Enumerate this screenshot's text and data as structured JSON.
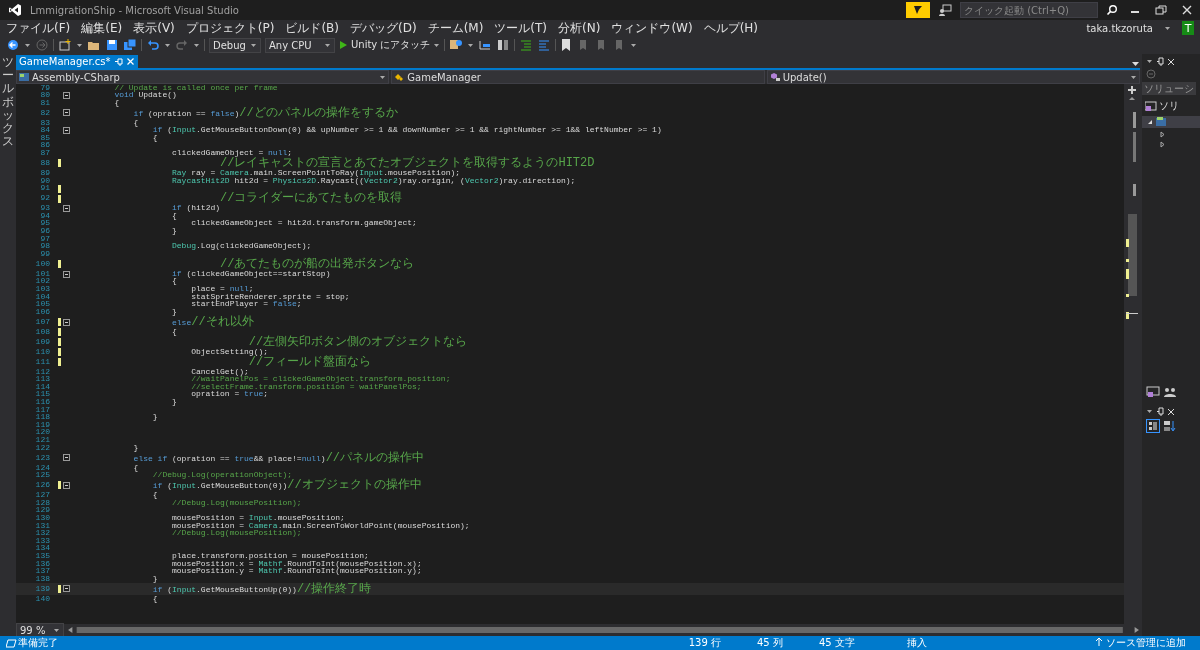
{
  "window": {
    "title": "LmmigrationShip - Microsoft Visual Studio"
  },
  "quick_launch": {
    "placeholder": "クイック起動 (Ctrl+Q)"
  },
  "menu": [
    "ファイル(F)",
    "編集(E)",
    "表示(V)",
    "プロジェクト(P)",
    "ビルド(B)",
    "デバッグ(D)",
    "チーム(M)",
    "ツール(T)",
    "分析(N)",
    "ウィンドウ(W)",
    "ヘルプ(H)"
  ],
  "account": {
    "user": "taka.tkzoruta",
    "avatar": "T"
  },
  "toolbar": {
    "configuration": "Debug",
    "platform": "Any CPU",
    "start": "Unity にアタッチ"
  },
  "toolbox": {
    "label": "ツールボックス"
  },
  "tabs": [
    {
      "label": "GameManager.cs*",
      "selected": true
    }
  ],
  "navigation": {
    "project": "Assembly-CSharp",
    "type": "GameManager",
    "member": "Update()"
  },
  "editor": {
    "zoom": "99 %",
    "lines": [
      {
        "n": "79",
        "changed": false,
        "fold": false,
        "current": false,
        "code": [
          {
            "kind": "comment",
            "t": "        // Update is called once per frame"
          }
        ]
      },
      {
        "n": "80",
        "changed": false,
        "fold": true,
        "current": false,
        "code": [
          {
            "kind": "keyword",
            "t": "        void"
          },
          {
            "kind": "plain",
            "t": " Update()"
          }
        ]
      },
      {
        "n": "81",
        "changed": false,
        "fold": false,
        "current": false,
        "code": [
          {
            "kind": "plain",
            "t": "        {"
          }
        ]
      },
      {
        "n": "82",
        "changed": false,
        "fold": true,
        "current": false,
        "code": [
          {
            "kind": "keyword",
            "t": "            if"
          },
          {
            "kind": "plain",
            "t": " (opration == "
          },
          {
            "kind": "keyword",
            "t": "false"
          },
          {
            "kind": "plain",
            "t": ")"
          },
          {
            "kind": "comment_ja",
            "t": "//どのパネルの操作をするか"
          }
        ]
      },
      {
        "n": "83",
        "changed": false,
        "fold": false,
        "current": false,
        "code": [
          {
            "kind": "plain",
            "t": "            {"
          }
        ]
      },
      {
        "n": "84",
        "changed": false,
        "fold": true,
        "current": false,
        "code": [
          {
            "kind": "keyword",
            "t": "                if"
          },
          {
            "kind": "plain",
            "t": " ("
          },
          {
            "kind": "type",
            "t": "Input"
          },
          {
            "kind": "plain",
            "t": ".GetMouseButtonDown(0) && upNumber >= 1 && downNumber >= 1 && rightNumber >= 1&& leftNumber >= 1)"
          }
        ]
      },
      {
        "n": "85",
        "changed": false,
        "fold": false,
        "current": false,
        "code": [
          {
            "kind": "plain",
            "t": "                {"
          }
        ]
      },
      {
        "n": "86",
        "changed": false,
        "fold": false,
        "current": false
      },
      {
        "n": "87",
        "changed": false,
        "fold": false,
        "current": false,
        "code": [
          {
            "kind": "plain",
            "t": "                    clickedGameObject = "
          },
          {
            "kind": "keyword",
            "t": "null"
          },
          {
            "kind": "plain",
            "t": ";"
          }
        ]
      },
      {
        "n": "88",
        "changed": true,
        "fold": false,
        "current": false,
        "code": [
          {
            "kind": "comment_ja",
            "t": "                    //レイキャストの宣言とあてたオブジェクトを取得するようのHIT2D"
          }
        ]
      },
      {
        "n": "89",
        "changed": false,
        "fold": false,
        "current": false,
        "code": [
          {
            "kind": "type",
            "t": "                    Ray"
          },
          {
            "kind": "plain",
            "t": " ray = "
          },
          {
            "kind": "type",
            "t": "Camera"
          },
          {
            "kind": "plain",
            "t": ".main.ScreenPointToRay("
          },
          {
            "kind": "type",
            "t": "Input"
          },
          {
            "kind": "plain",
            "t": ".mousePosition);"
          }
        ]
      },
      {
        "n": "90",
        "changed": false,
        "fold": false,
        "current": false,
        "code": [
          {
            "kind": "type",
            "t": "                    RaycastHit2D"
          },
          {
            "kind": "plain",
            "t": " hit2d = "
          },
          {
            "kind": "type",
            "t": "Physics2D"
          },
          {
            "kind": "plain",
            "t": ".Raycast(("
          },
          {
            "kind": "type",
            "t": "Vector2"
          },
          {
            "kind": "plain",
            "t": ")ray.origin, ("
          },
          {
            "kind": "type",
            "t": "Vector2"
          },
          {
            "kind": "plain",
            "t": ")ray.direction);"
          }
        ]
      },
      {
        "n": "91",
        "changed": true,
        "fold": false,
        "current": false
      },
      {
        "n": "92",
        "changed": true,
        "fold": false,
        "current": false,
        "code": [
          {
            "kind": "comment_ja",
            "t": "                    //コライダーにあてたものを取得"
          }
        ]
      },
      {
        "n": "93",
        "changed": false,
        "fold": true,
        "current": false,
        "code": [
          {
            "kind": "keyword",
            "t": "                    if"
          },
          {
            "kind": "plain",
            "t": " (hit2d)"
          }
        ]
      },
      {
        "n": "94",
        "changed": false,
        "fold": false,
        "current": false,
        "code": [
          {
            "kind": "plain",
            "t": "                    {"
          }
        ]
      },
      {
        "n": "95",
        "changed": false,
        "fold": false,
        "current": false,
        "code": [
          {
            "kind": "plain",
            "t": "                        clickedGameObject = hit2d.transform.gameObject;"
          }
        ]
      },
      {
        "n": "96",
        "changed": false,
        "fold": false,
        "current": false,
        "code": [
          {
            "kind": "plain",
            "t": "                    }"
          }
        ]
      },
      {
        "n": "97",
        "changed": false,
        "fold": false,
        "current": false
      },
      {
        "n": "98",
        "changed": false,
        "fold": false,
        "current": false,
        "code": [
          {
            "kind": "type",
            "t": "                    Debug"
          },
          {
            "kind": "plain",
            "t": ".Log(clickedGameObject);"
          }
        ]
      },
      {
        "n": "99",
        "changed": false,
        "fold": false,
        "current": false
      },
      {
        "n": "100",
        "changed": true,
        "fold": false,
        "current": false,
        "code": [
          {
            "kind": "comment_ja",
            "t": "                    //あてたものが船の出発ボタンなら"
          }
        ]
      },
      {
        "n": "101",
        "changed": false,
        "fold": true,
        "current": false,
        "code": [
          {
            "kind": "keyword",
            "t": "                    if"
          },
          {
            "kind": "plain",
            "t": " (clickedGameObject==startStop)"
          }
        ]
      },
      {
        "n": "102",
        "changed": false,
        "fold": false,
        "current": false,
        "code": [
          {
            "kind": "plain",
            "t": "                    {"
          }
        ]
      },
      {
        "n": "103",
        "changed": false,
        "fold": false,
        "current": false,
        "code": [
          {
            "kind": "plain",
            "t": "                        place = "
          },
          {
            "kind": "keyword",
            "t": "null"
          },
          {
            "kind": "plain",
            "t": ";"
          }
        ]
      },
      {
        "n": "104",
        "changed": false,
        "fold": false,
        "current": false,
        "code": [
          {
            "kind": "plain",
            "t": "                        statSpriteRenderer.sprite = stop;"
          }
        ]
      },
      {
        "n": "105",
        "changed": false,
        "fold": false,
        "current": false,
        "code": [
          {
            "kind": "plain",
            "t": "                        startEndPlayer = "
          },
          {
            "kind": "keyword",
            "t": "false"
          },
          {
            "kind": "plain",
            "t": ";"
          }
        ]
      },
      {
        "n": "106",
        "changed": false,
        "fold": false,
        "current": false,
        "code": [
          {
            "kind": "plain",
            "t": "                    }"
          }
        ]
      },
      {
        "n": "107",
        "changed": true,
        "fold": true,
        "current": false,
        "code": [
          {
            "kind": "keyword",
            "t": "                    else"
          },
          {
            "kind": "comment_ja",
            "t": "//それ以外"
          }
        ]
      },
      {
        "n": "108",
        "changed": true,
        "fold": false,
        "current": false,
        "code": [
          {
            "kind": "plain",
            "t": "                    {"
          }
        ]
      },
      {
        "n": "109",
        "changed": true,
        "fold": false,
        "current": false,
        "code": [
          {
            "kind": "comment_ja",
            "t": "                        //左側矢印ボタン側のオブジェクトなら"
          }
        ]
      },
      {
        "n": "110",
        "changed": true,
        "fold": false,
        "current": false,
        "code": [
          {
            "kind": "plain",
            "t": "                        ObjectSetting();"
          }
        ]
      },
      {
        "n": "111",
        "changed": true,
        "fold": false,
        "current": false,
        "code": [
          {
            "kind": "comment_ja",
            "t": "                        //フィールド盤面なら"
          }
        ]
      },
      {
        "n": "112",
        "changed": false,
        "fold": false,
        "current": false,
        "code": [
          {
            "kind": "plain",
            "t": "                        CancelGet();"
          }
        ]
      },
      {
        "n": "113",
        "changed": false,
        "fold": false,
        "current": false,
        "code": [
          {
            "kind": "comment",
            "t": "                        //waitPanelPos = clickedGameObject.transform.position;"
          }
        ]
      },
      {
        "n": "114",
        "changed": false,
        "fold": false,
        "current": false,
        "code": [
          {
            "kind": "comment",
            "t": "                        //selectFrame.transform.position = waitPanelPos;"
          }
        ]
      },
      {
        "n": "115",
        "changed": false,
        "fold": false,
        "current": false,
        "code": [
          {
            "kind": "plain",
            "t": "                        opration = "
          },
          {
            "kind": "keyword",
            "t": "true"
          },
          {
            "kind": "plain",
            "t": ";"
          }
        ]
      },
      {
        "n": "116",
        "changed": false,
        "fold": false,
        "current": false,
        "code": [
          {
            "kind": "plain",
            "t": "                    }"
          }
        ]
      },
      {
        "n": "117",
        "changed": false,
        "fold": false,
        "current": false
      },
      {
        "n": "118",
        "changed": false,
        "fold": false,
        "current": false,
        "code": [
          {
            "kind": "plain",
            "t": "                }"
          }
        ]
      },
      {
        "n": "119",
        "changed": false,
        "fold": false,
        "current": false
      },
      {
        "n": "120",
        "changed": false,
        "fold": false,
        "current": false
      },
      {
        "n": "121",
        "changed": false,
        "fold": false,
        "current": false
      },
      {
        "n": "122",
        "changed": false,
        "fold": false,
        "current": false,
        "code": [
          {
            "kind": "plain",
            "t": "            }"
          }
        ]
      },
      {
        "n": "123",
        "changed": false,
        "fold": true,
        "current": false,
        "code": [
          {
            "kind": "keyword",
            "t": "            else if"
          },
          {
            "kind": "plain",
            "t": " (opration == "
          },
          {
            "kind": "keyword",
            "t": "true"
          },
          {
            "kind": "plain",
            "t": "&& place!="
          },
          {
            "kind": "keyword",
            "t": "null"
          },
          {
            "kind": "plain",
            "t": ")"
          },
          {
            "kind": "comment_ja",
            "t": "//パネルの操作中"
          }
        ]
      },
      {
        "n": "124",
        "changed": false,
        "fold": false,
        "current": false,
        "code": [
          {
            "kind": "plain",
            "t": "            {"
          }
        ]
      },
      {
        "n": "125",
        "changed": false,
        "fold": false,
        "current": false,
        "code": [
          {
            "kind": "comment",
            "t": "                //Debug.Log(operationObject);"
          }
        ]
      },
      {
        "n": "126",
        "changed": true,
        "fold": true,
        "current": false,
        "code": [
          {
            "kind": "keyword",
            "t": "                if"
          },
          {
            "kind": "plain",
            "t": " ("
          },
          {
            "kind": "type",
            "t": "Input"
          },
          {
            "kind": "plain",
            "t": ".GetMouseButton(0))"
          },
          {
            "kind": "comment_ja",
            "t": "//オブジェクトの操作中"
          }
        ]
      },
      {
        "n": "127",
        "changed": false,
        "fold": false,
        "current": false,
        "code": [
          {
            "kind": "plain",
            "t": "                {"
          }
        ]
      },
      {
        "n": "128",
        "changed": false,
        "fold": false,
        "current": false,
        "code": [
          {
            "kind": "comment",
            "t": "                    //Debug.Log(mousePosition);"
          }
        ]
      },
      {
        "n": "129",
        "changed": false,
        "fold": false,
        "current": false
      },
      {
        "n": "130",
        "changed": false,
        "fold": false,
        "current": false,
        "code": [
          {
            "kind": "plain",
            "t": "                    mousePosition = "
          },
          {
            "kind": "type",
            "t": "Input"
          },
          {
            "kind": "plain",
            "t": ".mousePosition;"
          }
        ]
      },
      {
        "n": "131",
        "changed": false,
        "fold": false,
        "current": false,
        "code": [
          {
            "kind": "plain",
            "t": "                    mousePosition = "
          },
          {
            "kind": "type",
            "t": "Camera"
          },
          {
            "kind": "plain",
            "t": ".main.ScreenToWorldPoint(mousePosition);"
          }
        ]
      },
      {
        "n": "132",
        "changed": false,
        "fold": false,
        "current": false,
        "code": [
          {
            "kind": "comment",
            "t": "                    //Debug.Log(mousePosition);"
          }
        ]
      },
      {
        "n": "133",
        "changed": false,
        "fold": false,
        "current": false
      },
      {
        "n": "134",
        "changed": false,
        "fold": false,
        "current": false
      },
      {
        "n": "135",
        "changed": false,
        "fold": false,
        "current": false,
        "code": [
          {
            "kind": "plain",
            "t": "                    place.transform.position = mousePosition;"
          }
        ]
      },
      {
        "n": "136",
        "changed": false,
        "fold": false,
        "current": false,
        "code": [
          {
            "kind": "plain",
            "t": "                    mousePosition.x = "
          },
          {
            "kind": "type",
            "t": "Mathf"
          },
          {
            "kind": "plain",
            "t": ".RoundToInt(mousePosition.x);"
          }
        ]
      },
      {
        "n": "137",
        "changed": false,
        "fold": false,
        "current": false,
        "code": [
          {
            "kind": "plain",
            "t": "                    mousePosition.y = "
          },
          {
            "kind": "type",
            "t": "Mathf"
          },
          {
            "kind": "plain",
            "t": ".RoundToInt(mousePosition.y);"
          }
        ]
      },
      {
        "n": "138",
        "changed": false,
        "fold": false,
        "current": false,
        "code": [
          {
            "kind": "plain",
            "t": "                }"
          }
        ]
      },
      {
        "n": "139",
        "changed": true,
        "fold": true,
        "current": true,
        "code": [
          {
            "kind": "keyword",
            "t": "                if"
          },
          {
            "kind": "plain",
            "t": " ("
          },
          {
            "kind": "type",
            "t": "Input"
          },
          {
            "kind": "plain",
            "t": ".GetMouseButtonUp(0))"
          },
          {
            "kind": "comment_ja",
            "t": "//操作終了時"
          }
        ]
      },
      {
        "n": "140",
        "changed": false,
        "fold": false,
        "current": false,
        "code": [
          {
            "kind": "plain",
            "t": "                {"
          }
        ]
      }
    ]
  },
  "solution_explorer": {
    "title": "ソリューシ",
    "root": "ソリ"
  },
  "status_bar": {
    "message": "準備完了",
    "line": "139 行",
    "column": "45 列",
    "characters": "45 文字",
    "mode": "挿入",
    "source_control": "ソース管理に追加"
  }
}
